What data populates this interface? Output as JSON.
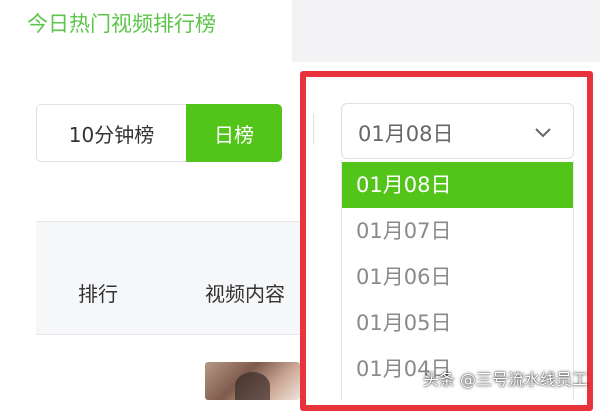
{
  "header": {
    "active_tab_label": "今日热门视频排行榜"
  },
  "ranking_toggle": {
    "options": [
      "10分钟榜",
      "日榜"
    ],
    "selected": "日榜"
  },
  "date_select": {
    "value": "01月08日",
    "options": [
      "01月08日",
      "01月07日",
      "01月06日",
      "01月05日",
      "01月04日"
    ]
  },
  "table": {
    "columns": [
      "排行",
      "视频内容"
    ]
  },
  "watermark": "头条 @三号流水线员工",
  "colors": {
    "accent": "#52c41a",
    "title_green": "#5dc54a",
    "highlight_frame": "#e8333c"
  }
}
